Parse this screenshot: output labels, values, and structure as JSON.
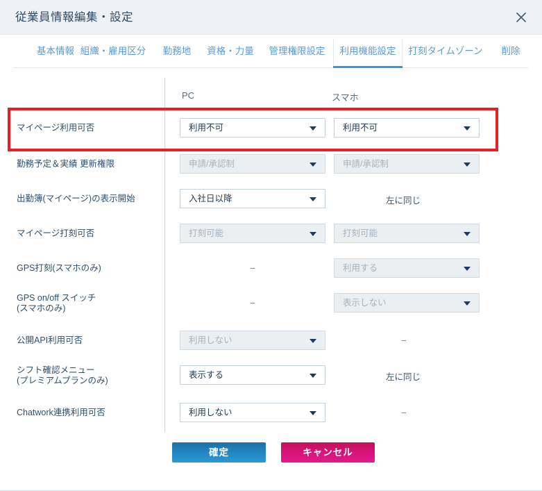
{
  "titlebar": {
    "title": "従業員情報編集・設定",
    "close_icon": "close-icon"
  },
  "tabs": [
    {
      "label": "基本情報",
      "active": false
    },
    {
      "label": "組織・雇用区分",
      "active": false
    },
    {
      "label": "勤務地",
      "active": false
    },
    {
      "label": "資格・力量",
      "active": false
    },
    {
      "label": "管理権限設定",
      "active": false
    },
    {
      "label": "利用機能設定",
      "active": true
    },
    {
      "label": "打刻タイムゾーン",
      "active": false
    },
    {
      "label": "削除",
      "active": false
    }
  ],
  "table": {
    "column_headers": {
      "pc": "PC",
      "smartphone": "スマホ"
    },
    "rows": [
      {
        "label": "マイページ利用可否",
        "pc": {
          "type": "dropdown",
          "value": "利用不可",
          "disabled": false
        },
        "smartphone": {
          "type": "dropdown",
          "value": "利用不可",
          "disabled": false
        },
        "highlighted": true
      },
      {
        "label": "勤務予定＆実績 更新権限",
        "pc": {
          "type": "dropdown",
          "value": "申請/承認制",
          "disabled": true
        },
        "smartphone": {
          "type": "dropdown",
          "value": "申請/承認制",
          "disabled": true
        },
        "highlighted": false
      },
      {
        "label": "出勤簿(マイページ)の表示開始",
        "pc": {
          "type": "dropdown",
          "value": "入社日以降",
          "disabled": false
        },
        "smartphone": {
          "type": "text",
          "value": "左に同じ"
        },
        "highlighted": false
      },
      {
        "label": "マイページ打刻可否",
        "pc": {
          "type": "dropdown",
          "value": "打刻可能",
          "disabled": true
        },
        "smartphone": {
          "type": "dropdown",
          "value": "打刻可能",
          "disabled": true
        },
        "highlighted": false
      },
      {
        "label": "GPS打刻(スマホのみ)",
        "pc": {
          "type": "dash",
          "value": "--"
        },
        "smartphone": {
          "type": "dropdown",
          "value": "利用する",
          "disabled": true
        },
        "highlighted": false
      },
      {
        "label": "GPS on/off スイッチ\n(スマホのみ)",
        "pc": {
          "type": "dash",
          "value": "--"
        },
        "smartphone": {
          "type": "dropdown",
          "value": "表示しない",
          "disabled": true
        },
        "highlighted": false
      },
      {
        "label": "公開API利用可否",
        "pc": {
          "type": "dropdown",
          "value": "利用しない",
          "disabled": true
        },
        "smartphone": {
          "type": "dash",
          "value": "--"
        },
        "highlighted": false
      },
      {
        "label": "シフト確認メニュー\n(プレミアムプランのみ)",
        "pc": {
          "type": "dropdown",
          "value": "表示する",
          "disabled": false
        },
        "smartphone": {
          "type": "text",
          "value": "左に同じ"
        },
        "highlighted": false
      },
      {
        "label": "Chatwork連携利用可否",
        "pc": {
          "type": "dropdown",
          "value": "利用しない",
          "disabled": false
        },
        "smartphone": {
          "type": "dash",
          "value": "--"
        },
        "highlighted": false
      }
    ]
  },
  "footer": {
    "confirm_label": "確定",
    "cancel_label": "キャンセル"
  },
  "colors": {
    "titlebar_bg": "#eef2f6",
    "tab_text": "#5b9bd5",
    "active_tab_underline": "#3498db",
    "highlight_border": "#ee1c25",
    "confirm_button": "#2389c4",
    "cancel_button": "#d9157a"
  }
}
